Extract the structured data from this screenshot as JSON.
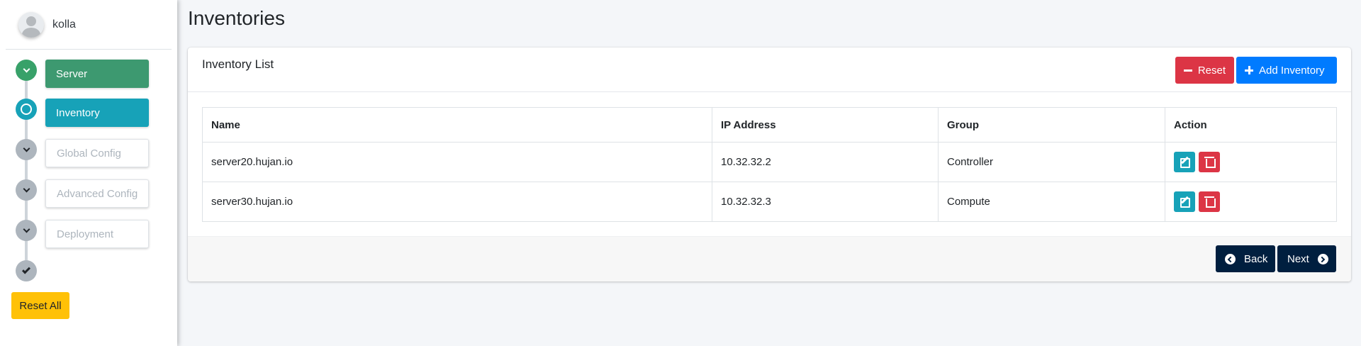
{
  "user": {
    "name": "kolla"
  },
  "steps": [
    {
      "label": "Server",
      "state": "done",
      "node_icon": "chevron-down-icon"
    },
    {
      "label": "Inventory",
      "state": "active",
      "node_icon": "circle-icon"
    },
    {
      "label": "Global Config",
      "state": "disabled",
      "node_icon": "chevron-down-icon"
    },
    {
      "label": "Advanced Config",
      "state": "disabled",
      "node_icon": "chevron-down-icon"
    },
    {
      "label": "Deployment",
      "state": "disabled",
      "node_icon": "chevron-down-icon"
    },
    {
      "label": "",
      "state": "final",
      "node_icon": "check-icon"
    }
  ],
  "reset_all_label": "Reset All",
  "page_title": "Inventories",
  "card": {
    "title": "Inventory List",
    "reset_label": "Reset",
    "add_label": "Add Inventory"
  },
  "table": {
    "headers": [
      "Name",
      "IP Address",
      "Group",
      "Action"
    ],
    "rows": [
      {
        "name": "server20.hujan.io",
        "ip": "10.32.32.2",
        "group": "Controller"
      },
      {
        "name": "server30.hujan.io",
        "ip": "10.32.32.3",
        "group": "Compute"
      }
    ]
  },
  "footer": {
    "back_label": "Back",
    "next_label": "Next"
  },
  "colors": {
    "success": "#3d9970",
    "info": "#17a2b8",
    "danger": "#dc3545",
    "primary": "#007bff",
    "navy": "#001f3f",
    "warning": "#ffc107"
  }
}
